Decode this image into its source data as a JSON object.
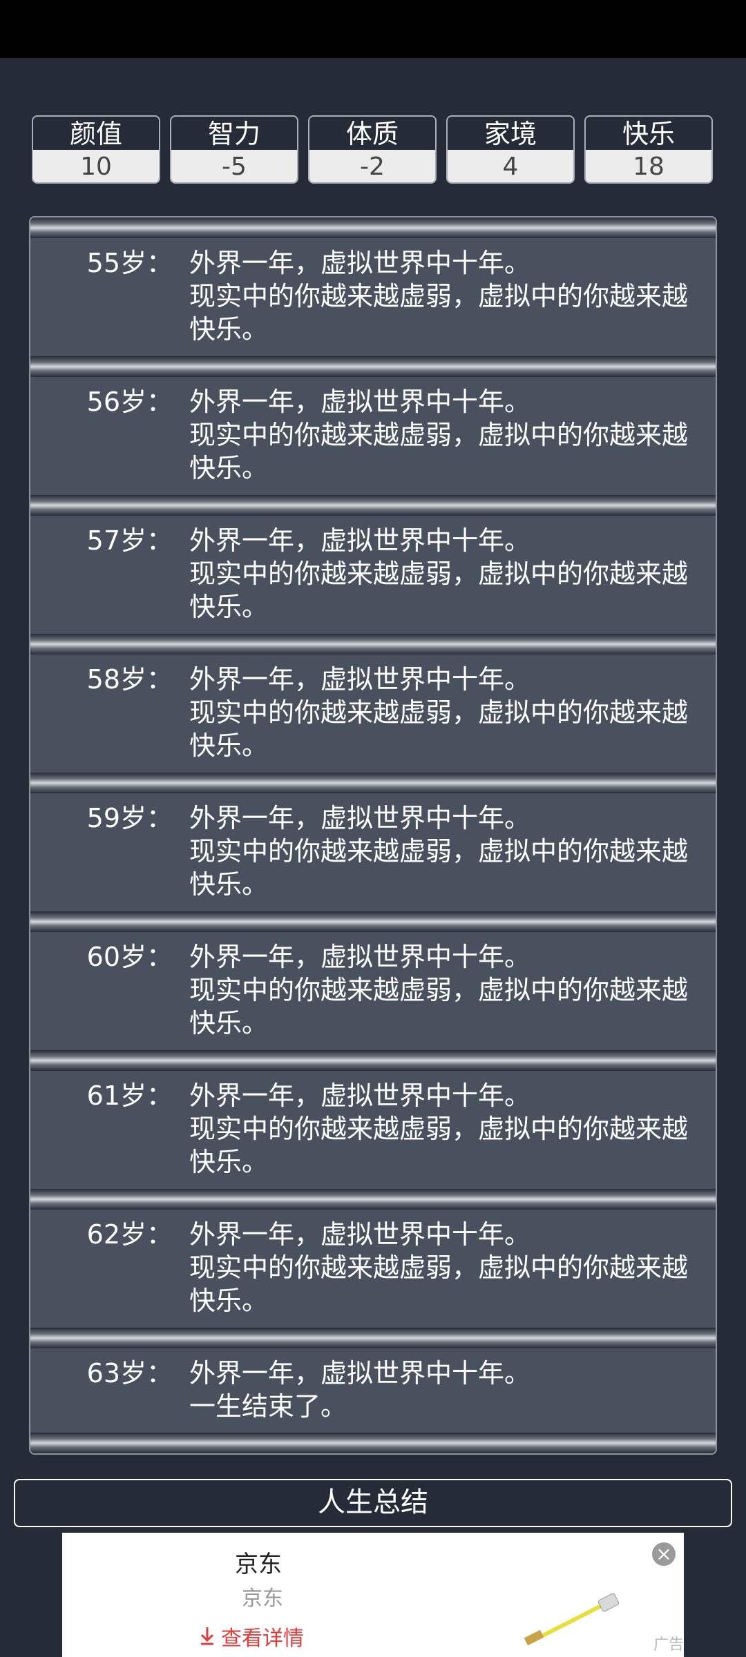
{
  "stats": [
    {
      "label": "颜值",
      "value": "10"
    },
    {
      "label": "智力",
      "value": "-5"
    },
    {
      "label": "体质",
      "value": "-2"
    },
    {
      "label": "家境",
      "value": "4"
    },
    {
      "label": "快乐",
      "value": "18"
    }
  ],
  "entries": [
    {
      "age": "55岁：",
      "line1": "外界一年，虚拟世界中十年。",
      "line2": "现实中的你越来越虚弱，虚拟中的你越来越快乐。"
    },
    {
      "age": "56岁：",
      "line1": "外界一年，虚拟世界中十年。",
      "line2": "现实中的你越来越虚弱，虚拟中的你越来越快乐。"
    },
    {
      "age": "57岁：",
      "line1": "外界一年，虚拟世界中十年。",
      "line2": "现实中的你越来越虚弱，虚拟中的你越来越快乐。"
    },
    {
      "age": "58岁：",
      "line1": "外界一年，虚拟世界中十年。",
      "line2": "现实中的你越来越虚弱，虚拟中的你越来越快乐。"
    },
    {
      "age": "59岁：",
      "line1": "外界一年，虚拟世界中十年。",
      "line2": "现实中的你越来越虚弱，虚拟中的你越来越快乐。"
    },
    {
      "age": "60岁：",
      "line1": "外界一年，虚拟世界中十年。",
      "line2": "现实中的你越来越虚弱，虚拟中的你越来越快乐。"
    },
    {
      "age": "61岁：",
      "line1": "外界一年，虚拟世界中十年。",
      "line2": "现实中的你越来越虚弱，虚拟中的你越来越快乐。"
    },
    {
      "age": "62岁：",
      "line1": "外界一年，虚拟世界中十年。",
      "line2": "现实中的你越来越虚弱，虚拟中的你越来越快乐。"
    },
    {
      "age": "63岁：",
      "line1": "外界一年，虚拟世界中十年。",
      "line2": "一生结束了。"
    }
  ],
  "summary_button": "人生总结",
  "ad": {
    "title": "京东",
    "subtitle": "京东",
    "cta": "查看详情",
    "mark": "广告",
    "cta_icon": "download-arrow-icon",
    "close_icon": "close-icon"
  }
}
